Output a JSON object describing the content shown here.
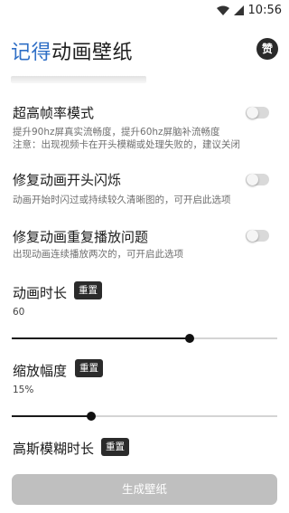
{
  "status_bar": {
    "time": "10:56"
  },
  "header": {
    "title_accent": "记得",
    "title_rest": "动画壁纸",
    "donate_label": "赞"
  },
  "settings": {
    "high_refresh": {
      "title": "超高帧率模式",
      "desc_1": "提升90hz屏真实流畅度，提升60hz屏脑补流畅度",
      "desc_2": "注意：出现视频卡在开头模糊或处理失败的，建议关闭",
      "enabled": false
    },
    "fix_flicker": {
      "title": "修复动画开头闪烁",
      "desc": "动画开始时闪过或持续较久清晰图的，可开启此选项",
      "enabled": false
    },
    "fix_repeat": {
      "title": "修复动画重复播放问题",
      "desc": "出现动画连续播放两次的，可开启此选项",
      "enabled": false
    },
    "duration": {
      "title": "动画时长",
      "reset_label": "重置",
      "value": "60",
      "level": 0.67
    },
    "scale": {
      "title": "缩放幅度",
      "reset_label": "重置",
      "value": "15%",
      "level": 0.3
    },
    "blur": {
      "title": "高斯模糊时长",
      "reset_label": "重置"
    }
  },
  "footer": {
    "generate_label": "生成壁纸"
  },
  "colors": {
    "accent": "#2f6fc6",
    "button_disabled": "#bfbfbf",
    "slider_fill": "#1a1a1a"
  }
}
